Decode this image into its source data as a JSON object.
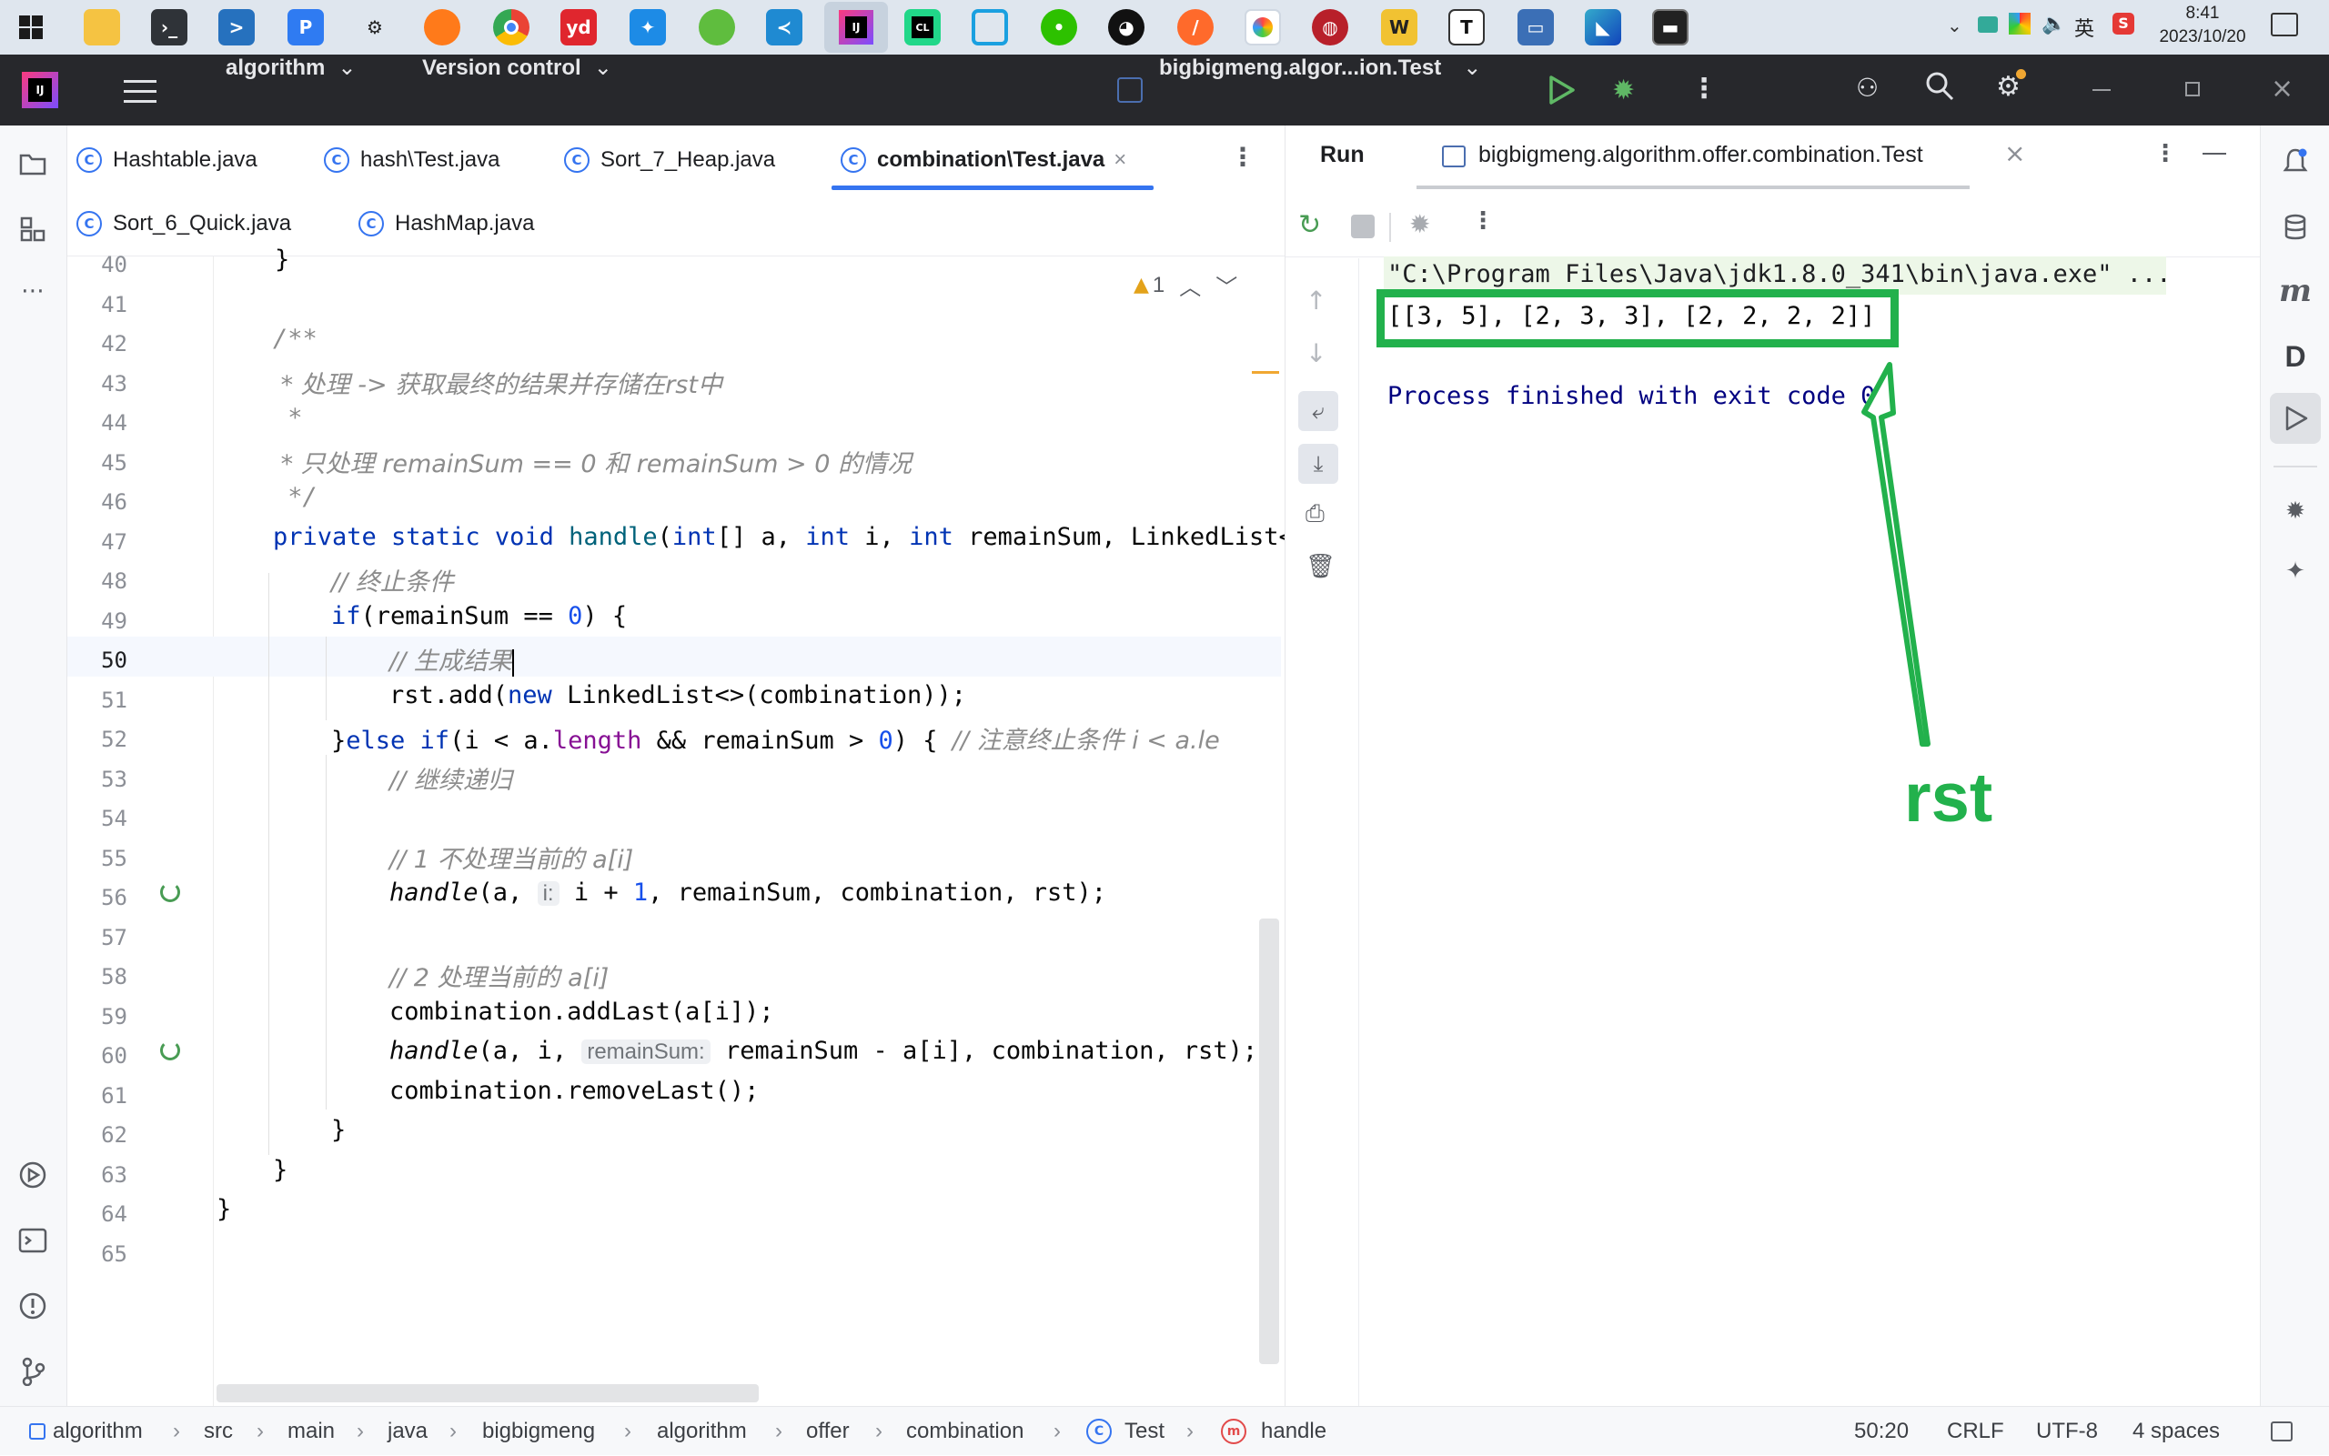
{
  "taskbar": {
    "apps": [
      "start",
      "file-explorer",
      "terminal",
      "powershell",
      "browser-p",
      "settings",
      "firefox",
      "chrome",
      "youdao",
      "app-blue",
      "app-green",
      "vscode",
      "intellij",
      "clion",
      "app-frame",
      "wechat",
      "qq",
      "app-orange",
      "app-colorful",
      "app-red",
      "wps",
      "typora",
      "remote-desktop",
      "app-stack",
      "console"
    ],
    "youdao_label": "yd",
    "typora_label": "T",
    "tray_lang": "英",
    "time": "8:41",
    "date": "2023/10/20"
  },
  "titlebar": {
    "project": "algorithm",
    "vcs": "Version control",
    "run_config": "bigbigmeng.algor...ion.Test"
  },
  "editor": {
    "tabs_row1": [
      "Hashtable.java",
      "hash\\Test.java",
      "Sort_7_Heap.java",
      "combination\\Test.java"
    ],
    "tabs_row2": [
      "Sort_6_Quick.java",
      "HashMap.java"
    ],
    "warning_count": "1",
    "lines": [
      "40",
      "41",
      "42",
      "43",
      "44",
      "45",
      "46",
      "47",
      "48",
      "49",
      "50",
      "51",
      "52",
      "53",
      "54",
      "55",
      "56",
      "57",
      "58",
      "59",
      "60",
      "61",
      "62",
      "63",
      "64",
      "65"
    ],
    "code": {
      "l40": "}",
      "l42": "/**",
      "l43": " * 处理 -> 获取最终的结果并存储在rst中",
      "l44": " *",
      "l45": " * 只处理 remainSum == 0 和 remainSum > 0 的情况",
      "l46": " */",
      "l47_a": "private static void ",
      "l47_b": "handle",
      "l47_c": "(",
      "l47_d": "int",
      "l47_e": "[] a, ",
      "l47_f": "int",
      "l47_g": " i, ",
      "l47_h": "int",
      "l47_i": " remainSum, LinkedList<",
      "l48": "// 终止条件",
      "l49_a": "if",
      "l49_b": "(remainSum == ",
      "l49_c": "0",
      "l49_d": ") {",
      "l50": "// 生成结果",
      "l51_a": "rst.add(",
      "l51_b": "new",
      "l51_c": " LinkedList<>(combination));",
      "l52_a": "}",
      "l52_b": "else if",
      "l52_c": "(i < a.",
      "l52_d": "length",
      "l52_e": " && remainSum > ",
      "l52_f": "0",
      "l52_g": ") { ",
      "l52_h": "// 注意终止条件 i < a.le",
      "l53": "// 继续递归",
      "l55": "// 1 不处理当前的 a[i]",
      "l56_a": "handle",
      "l56_b": "(a, ",
      "l56_hint": "i:",
      "l56_c": " i + ",
      "l56_d": "1",
      "l56_e": ", remainSum, combination, rst);",
      "l58": "// 2 处理当前的 a[i]",
      "l59": "combination.addLast(a[i]);",
      "l60_a": "handle",
      "l60_b": "(a, i, ",
      "l60_hint": "remainSum:",
      "l60_c": " remainSum - a[i], combination, rst);",
      "l61": "combination.removeLast();",
      "l62": "}",
      "l63": "}",
      "l64": "}"
    }
  },
  "run": {
    "title": "Run",
    "tab": "bigbigmeng.algorithm.offer.combination.Test",
    "cmd": "\"C:\\Program Files\\Java\\jdk1.8.0_341\\bin\\java.exe\" ...",
    "result": "[[3, 5], [2, 3, 3], [2, 2, 2, 2]]",
    "process": "Process finished with exit code 0",
    "annotation": "rst",
    "annotation_color": "#22b14c"
  },
  "statusbar": {
    "breadcrumbs": [
      "algorithm",
      "src",
      "main",
      "java",
      "bigbigmeng",
      "algorithm",
      "offer",
      "combination",
      "Test",
      "handle"
    ],
    "position": "50:20",
    "line_sep": "CRLF",
    "encoding": "UTF-8",
    "indent": "4 spaces"
  },
  "right_strip": {
    "m_label": "m",
    "d_label": "D"
  }
}
